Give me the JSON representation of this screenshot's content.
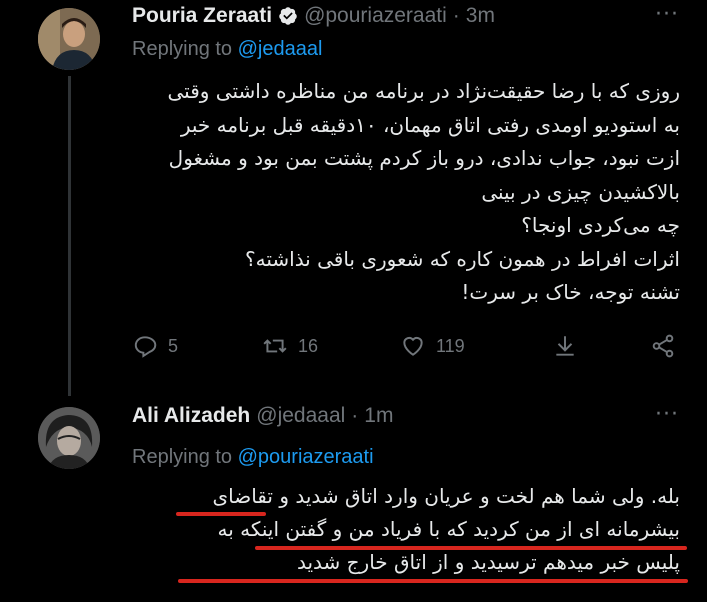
{
  "tweet1": {
    "name": "Pouria Zeraati",
    "handle": "@pouriazeraati",
    "dot": "·",
    "time": "3m",
    "replying_prefix": "Replying to ",
    "replying_to": "@jedaaal",
    "lines": [
      "روزی که با رضا حقیقت‌نژاد در برنامه من مناظره داشتی وقتی",
      "به استودیو اومدی رفتی اتاق مهمان، ۱۰دقیقه قبل برنامه خبر",
      "ازت نبود، جواب ندادی، درو باز کردم پشتت بمن بود و مشغول",
      "بالاکشیدن چیزی در بینی",
      "چه می‌کردی اونجا؟",
      "اثرات افراط در همون کاره که شعوری باقی نذاشته؟",
      "تشنه توجه، خاک بر سرت!"
    ],
    "actions": {
      "reply_count": "5",
      "retweet_count": "16",
      "like_count": "119"
    }
  },
  "tweet2": {
    "name": "Ali Alizadeh",
    "handle": "@jedaaal",
    "dot": "·",
    "time": "1m",
    "replying_prefix": "Replying to ",
    "replying_to": "@pouriazeraati",
    "lines": [
      "بله. ولی شما هم لخت و عریان وارد اتاق شدید و تقاضای",
      "بیشرمانه ای از من کردید که با فریاد من و گفتن اینکه به",
      "پلیس خبر میدهم ترسیدید و از اتاق خارج شدید"
    ]
  },
  "more_glyph": "···",
  "colors": {
    "background": "#000000",
    "text": "#e7e9ea",
    "muted": "#71767b",
    "link": "#1d9bf0",
    "verified": "#e7e9ea",
    "underline": "#d7261e"
  }
}
